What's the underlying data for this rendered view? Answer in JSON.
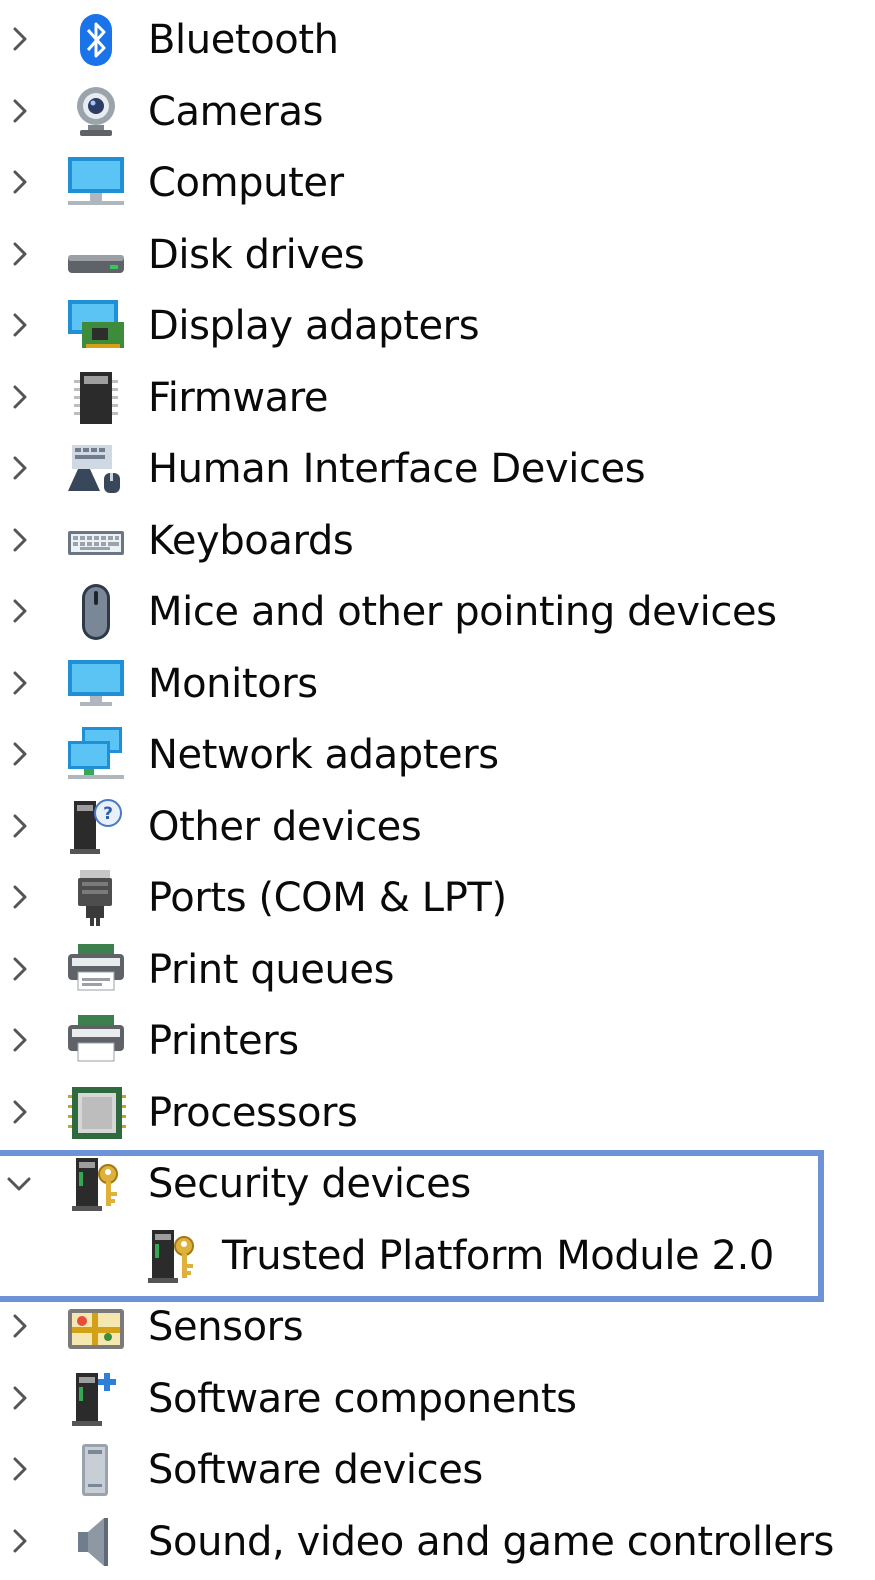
{
  "colors": {
    "highlight_border": "#6d93d6",
    "chevron": "#555555",
    "text": "#0a0a0a"
  },
  "tree": {
    "items": [
      {
        "label": "Bluetooth",
        "icon": "bluetooth-icon",
        "expanded": false
      },
      {
        "label": "Cameras",
        "icon": "camera-icon",
        "expanded": false
      },
      {
        "label": "Computer",
        "icon": "computer-icon",
        "expanded": false
      },
      {
        "label": "Disk drives",
        "icon": "disk-drive-icon",
        "expanded": false
      },
      {
        "label": "Display adapters",
        "icon": "display-adapter-icon",
        "expanded": false
      },
      {
        "label": "Firmware",
        "icon": "firmware-chip-icon",
        "expanded": false
      },
      {
        "label": "Human Interface Devices",
        "icon": "human-interface-device-icon",
        "expanded": false
      },
      {
        "label": "Keyboards",
        "icon": "keyboard-icon",
        "expanded": false
      },
      {
        "label": "Mice and other pointing devices",
        "icon": "mouse-icon",
        "expanded": false
      },
      {
        "label": "Monitors",
        "icon": "monitor-icon",
        "expanded": false
      },
      {
        "label": "Network adapters",
        "icon": "network-adapter-icon",
        "expanded": false
      },
      {
        "label": "Other devices",
        "icon": "unknown-device-icon",
        "expanded": false
      },
      {
        "label": "Ports (COM & LPT)",
        "icon": "port-connector-icon",
        "expanded": false
      },
      {
        "label": "Print queues",
        "icon": "print-queue-icon",
        "expanded": false
      },
      {
        "label": "Printers",
        "icon": "printer-icon",
        "expanded": false
      },
      {
        "label": "Processors",
        "icon": "processor-icon",
        "expanded": false
      },
      {
        "label": "Security devices",
        "icon": "security-device-icon",
        "expanded": true,
        "children": [
          {
            "label": "Trusted Platform Module 2.0",
            "icon": "security-device-icon"
          }
        ]
      },
      {
        "label": "Sensors",
        "icon": "sensor-icon",
        "expanded": false
      },
      {
        "label": "Software components",
        "icon": "software-component-icon",
        "expanded": false
      },
      {
        "label": "Software devices",
        "icon": "software-device-icon",
        "expanded": false
      },
      {
        "label": "Sound, video and game controllers",
        "icon": "speaker-icon",
        "expanded": false
      }
    ]
  }
}
